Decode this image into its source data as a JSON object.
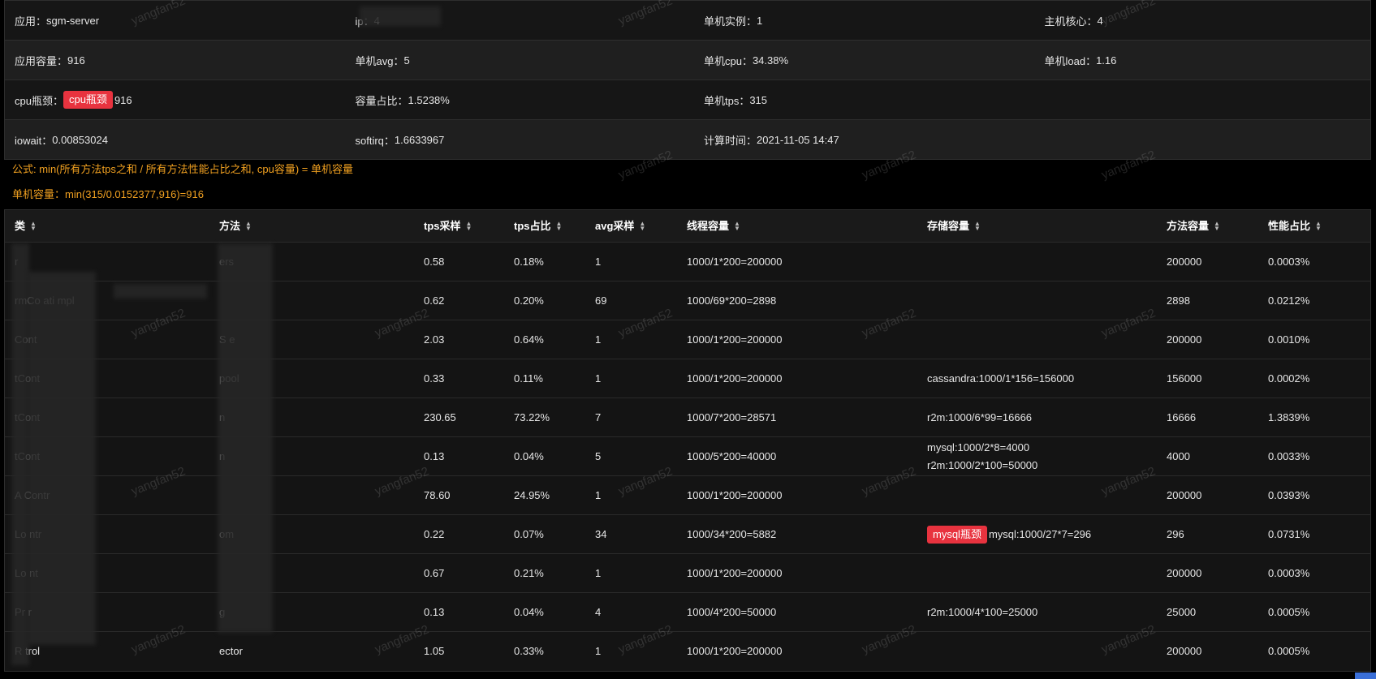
{
  "info": {
    "rows": [
      [
        {
          "label": "应用：",
          "value": "sgm-server"
        },
        {
          "label": "ip：",
          "value": "4"
        },
        {
          "label": "单机实例：",
          "value": "1"
        },
        {
          "label": "主机核心：",
          "value": "4"
        }
      ],
      [
        {
          "label": "应用容量：",
          "value": "916"
        },
        {
          "label": "单机avg：",
          "value": "5"
        },
        {
          "label": "单机cpu：",
          "value": "34.38%"
        },
        {
          "label": "单机load：",
          "value": "1.16"
        }
      ],
      [
        {
          "label": "cpu瓶颈：",
          "badge": "cpu瓶颈",
          "value": "916"
        },
        {
          "label": "容量占比：",
          "value": "1.5238%"
        },
        {
          "label": "单机tps：",
          "value": "315"
        },
        {
          "label": "",
          "value": ""
        }
      ],
      [
        {
          "label": "iowait：",
          "value": "0.00853024"
        },
        {
          "label": "softirq：",
          "value": "1.6633967"
        },
        {
          "label": "计算时间：",
          "value": "2021-11-05 14:47"
        },
        {
          "label": "",
          "value": ""
        }
      ]
    ]
  },
  "formula": {
    "line1": "公式: min(所有方法tps之和 / 所有方法性能占比之和, cpu容量) = 单机容量",
    "line2": "单机容量：min(315/0.0152377,916)=916"
  },
  "table": {
    "headers": [
      "类",
      "方法",
      "tps采样",
      "tps占比",
      "avg采样",
      "线程容量",
      "存储容量",
      "方法容量",
      "性能占比"
    ],
    "rows": [
      {
        "cls": "r",
        "method": "ers",
        "tps": "0.58",
        "ratio": "0.18%",
        "avg": "1",
        "thread": "1000/1*200=200000",
        "storage": [],
        "storage_badge": "",
        "mcap": "200000",
        "perf": "0.0003%"
      },
      {
        "cls": "rmCo ati mpl",
        "method": "",
        "tps": "0.62",
        "ratio": "0.20%",
        "avg": "69",
        "thread": "1000/69*200=2898",
        "storage": [],
        "storage_badge": "",
        "mcap": "2898",
        "perf": "0.0212%"
      },
      {
        "cls": "Cont",
        "method": "S e",
        "tps": "2.03",
        "ratio": "0.64%",
        "avg": "1",
        "thread": "1000/1*200=200000",
        "storage": [],
        "storage_badge": "",
        "mcap": "200000",
        "perf": "0.0010%"
      },
      {
        "cls": "tCont",
        "method": "pool",
        "tps": "0.33",
        "ratio": "0.11%",
        "avg": "1",
        "thread": "1000/1*200=200000",
        "storage": [
          "cassandra:1000/1*156=156000"
        ],
        "storage_badge": "",
        "mcap": "156000",
        "perf": "0.0002%"
      },
      {
        "cls": "tCont",
        "method": "n",
        "tps": "230.65",
        "ratio": "73.22%",
        "avg": "7",
        "thread": "1000/7*200=28571",
        "storage": [
          "r2m:1000/6*99=16666"
        ],
        "storage_badge": "",
        "mcap": "16666",
        "perf": "1.3839%"
      },
      {
        "cls": "tCont",
        "method": "n",
        "tps": "0.13",
        "ratio": "0.04%",
        "avg": "5",
        "thread": "1000/5*200=40000",
        "storage": [
          "mysql:1000/2*8=4000",
          "r2m:1000/2*100=50000"
        ],
        "storage_badge": "",
        "mcap": "4000",
        "perf": "0.0033%"
      },
      {
        "cls": "A Contr",
        "method": "",
        "tps": "78.60",
        "ratio": "24.95%",
        "avg": "1",
        "thread": "1000/1*200=200000",
        "storage": [],
        "storage_badge": "",
        "mcap": "200000",
        "perf": "0.0393%"
      },
      {
        "cls": "Lo ntr",
        "method": "om",
        "tps": "0.22",
        "ratio": "0.07%",
        "avg": "34",
        "thread": "1000/34*200=5882",
        "storage": [
          "mysql:1000/27*7=296"
        ],
        "storage_badge": "mysql瓶颈",
        "mcap": "296",
        "perf": "0.0731%"
      },
      {
        "cls": "Lo nt",
        "method": "",
        "tps": "0.67",
        "ratio": "0.21%",
        "avg": "1",
        "thread": "1000/1*200=200000",
        "storage": [],
        "storage_badge": "",
        "mcap": "200000",
        "perf": "0.0003%"
      },
      {
        "cls": "Pr r",
        "method": "g",
        "tps": "0.13",
        "ratio": "0.04%",
        "avg": "4",
        "thread": "1000/4*200=50000",
        "storage": [
          "r2m:1000/4*100=25000"
        ],
        "storage_badge": "",
        "mcap": "25000",
        "perf": "0.0005%"
      },
      {
        "cls": "R trol",
        "method": "ector",
        "tps": "1.05",
        "ratio": "0.33%",
        "avg": "1",
        "thread": "1000/1*200=200000",
        "storage": [],
        "storage_badge": "",
        "mcap": "200000",
        "perf": "0.0005%"
      }
    ]
  },
  "watermark": "yangfan52",
  "colors": {
    "badge": "#e8333f",
    "formula": "#f0a020",
    "background": "#000000",
    "accent": "#3a6fd8"
  }
}
